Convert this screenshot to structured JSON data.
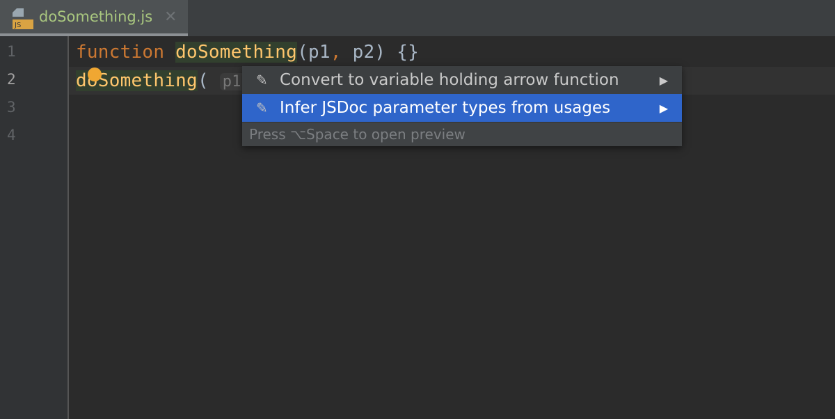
{
  "tab": {
    "filename": "doSomething.js",
    "icon": "js-file-icon",
    "icon_label": "JS",
    "close_icon": "close-icon"
  },
  "gutter": {
    "lines": [
      "1",
      "2",
      "3",
      "4"
    ]
  },
  "code": {
    "line1": {
      "keyword": "function ",
      "name": "doSomething",
      "params": "(p1",
      "comma": ",",
      "rest": " p2) {}"
    },
    "line2": {
      "name": "doSomething",
      "paren": "(",
      "hint": "p1:"
    }
  },
  "popup": {
    "items": [
      {
        "label": "Convert to variable holding arrow function",
        "icon": "intention-edit-icon",
        "selected": false
      },
      {
        "label": "Infer JSDoc parameter types from usages",
        "icon": "intention-edit-icon",
        "selected": true
      }
    ],
    "footer": "Press ⌥Space to open preview"
  },
  "colors": {
    "keyword": "#cc7832",
    "function": "#ffc66d",
    "selection": "#2f65ca",
    "bulb": "#f0a732"
  }
}
